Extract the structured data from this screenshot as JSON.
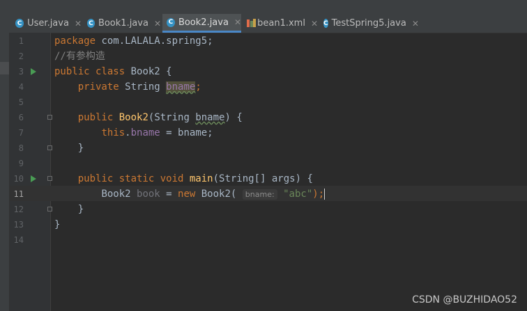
{
  "tabs": [
    {
      "label": "User.java",
      "kind": "java",
      "active": false
    },
    {
      "label": "Book1.java",
      "kind": "java",
      "active": false
    },
    {
      "label": "Book2.java",
      "kind": "java",
      "active": true
    },
    {
      "label": "bean1.xml",
      "kind": "xml",
      "active": false
    },
    {
      "label": "TestSpring5.java",
      "kind": "java",
      "active": false
    }
  ],
  "editor": {
    "line_numbers": [
      "1",
      "2",
      "3",
      "4",
      "5",
      "6",
      "7",
      "8",
      "9",
      "10",
      "11",
      "12",
      "13",
      "14"
    ],
    "current_line": "11",
    "code": {
      "l1_kw": "package",
      "l1_pkg": " com.LALALA.spring5;",
      "l2_comment": "//有参构造",
      "l3_kw": "public class",
      "l3_name": " Book2 {",
      "l4_kw": "private",
      "l4_type": " String ",
      "l4_field": "bname",
      "l4_end": ";",
      "l6_kw": "public",
      "l6_name": "Book2",
      "l6_params_a": "(String ",
      "l6_param": "bname",
      "l6_params_b": ") {",
      "l7_this": "this",
      "l7_dot": ".",
      "l7_field": "bname",
      "l7_rest": " = bname;",
      "l8_brace": "}",
      "l10_kw": "public static void",
      "l10_name": "main",
      "l10_params": "(String[] args) {",
      "l11_type": "Book2 ",
      "l11_var": "book",
      "l11_eq": " = ",
      "l11_new": "new",
      "l11_ctor": " Book2(",
      "l11_hint": "bname:",
      "l11_str": "\"abc\"",
      "l11_end": ");",
      "l12_brace": "}",
      "l13_brace": "}"
    }
  },
  "watermark": "CSDN @BUZHIDAO52"
}
